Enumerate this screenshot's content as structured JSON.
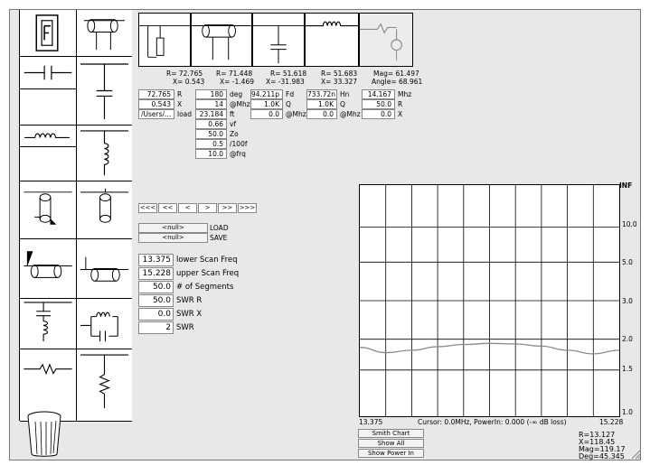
{
  "readouts": [
    {
      "r": "R=  72.765",
      "x": "X=  0.543"
    },
    {
      "r": "R=  71.448",
      "x": "X=  -1.469"
    },
    {
      "r": "R=  51.618",
      "x": "X=  -31.983"
    },
    {
      "r": "R=  51.683",
      "x": "X=  33.327"
    },
    {
      "r": "Mag= 61.497",
      "x": "Angle= 68.961"
    }
  ],
  "col1": {
    "r_value": "72.765",
    "r_label": "R",
    "x_value": "0.543",
    "x_label": "X",
    "load_value": "/Users/...",
    "load_label": "load"
  },
  "col2": {
    "deg_value": "180",
    "deg_label": "deg",
    "mhz_value": "14",
    "mhz_label": "@Mhz",
    "ft_value": "23.184",
    "ft_label": "ft",
    "vf_value": "0.66",
    "vf_label": "vf",
    "zo_value": "50.0",
    "zo_label": "Zo",
    "loss_value": "0.5",
    "loss_label": "/100f",
    "frq_value": "10.0",
    "frq_label": "@frq"
  },
  "col3": {
    "fd_value": "94.211p",
    "fd_label": "Fd",
    "q_value": "1.0K",
    "q_label": "Q",
    "mhz_value": "0.0",
    "mhz_label": "@Mhz"
  },
  "col4": {
    "hn_value": "733.72n",
    "hn_label": "Hn",
    "q_value": "1.0K",
    "q_label": "Q",
    "mhz_value": "0.0",
    "mhz_label": "@Mhz"
  },
  "col5": {
    "freq_value": "14.167",
    "freq_label": "Mhz",
    "r_value": "50.0",
    "r_label": "R",
    "x_value": "0.0",
    "x_label": "X"
  },
  "nav": [
    "<<<",
    "<<",
    "<",
    ">",
    ">>",
    ">>>"
  ],
  "file": {
    "load_btn": "<null>",
    "load_label": "LOAD",
    "save_btn": "<null>",
    "save_label": "SAVE"
  },
  "scan": [
    {
      "value": "13.375",
      "label": "lower Scan Freq"
    },
    {
      "value": "15.228",
      "label": "upper Scan Freq"
    },
    {
      "value": "50.0",
      "label": "# of Segments"
    },
    {
      "value": "50.0",
      "label": "SWR R"
    },
    {
      "value": "0.0",
      "label": "SWR X"
    },
    {
      "value": "2",
      "label": "SWR"
    }
  ],
  "plot": {
    "y_top_label": "INF",
    "y_labels": [
      "10.0",
      "5.0",
      "3.0",
      "2.0",
      "1.5",
      "1.0"
    ],
    "x_min": "13.375",
    "x_max": "15.228",
    "cursor_text": "Cursor: 0.0MHz, PowerIn: 0.000 (-∞ dB loss)",
    "curve_color": "#8a8a8a"
  },
  "chart_data": {
    "type": "line",
    "title": "",
    "xlabel": "",
    "ylabel": "",
    "xlim": [
      13.375,
      15.228
    ],
    "y_scale": "SWR (1.0, 1.5, 2.0, 3.0, 5.0, 10.0, INF)",
    "series": [
      {
        "x": [
          13.375,
          13.56,
          13.745,
          13.93,
          14.116,
          14.301,
          14.486,
          14.671,
          14.857,
          15.042,
          15.228
        ],
        "values": [
          1.85,
          1.76,
          1.8,
          1.86,
          1.9,
          1.92,
          1.91,
          1.87,
          1.8,
          1.74,
          1.8
        ]
      }
    ]
  },
  "buttons": {
    "smith": "Smith Chart",
    "show_all": "Show All",
    "show_power": "Show Power In"
  },
  "stats": {
    "r": "R=13.127",
    "x": "X=118.45",
    "mag": "Mag=119.17",
    "deg": "Deg=45.345"
  }
}
